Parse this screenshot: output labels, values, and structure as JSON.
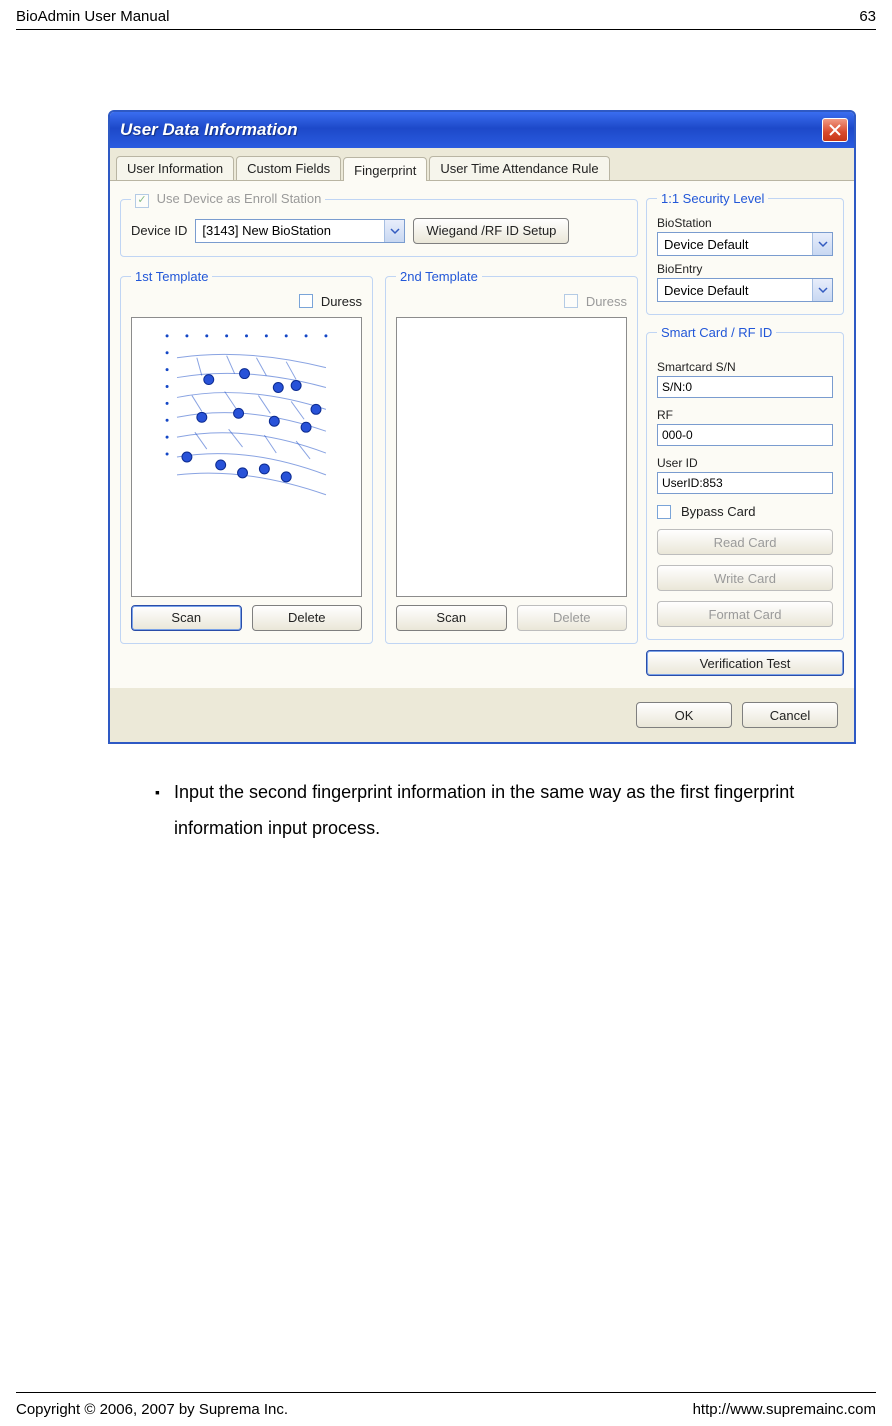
{
  "page_header": {
    "title": "BioAdmin User Manual",
    "page_number": "63"
  },
  "page_footer": {
    "copyright": "Copyright © 2006, 2007 by Suprema Inc.",
    "url": "http://www.supremainc.com"
  },
  "dialog": {
    "title": "User Data Information",
    "tabs": [
      "User Information",
      "Custom Fields",
      "Fingerprint",
      "User Time Attendance Rule"
    ],
    "active_tab_index": 2,
    "enroll": {
      "legend": "Use Device as Enroll Station",
      "device_id_label": "Device ID",
      "device_value": "[3143] New BioStation",
      "wiegand_btn": "Wiegand /RF ID Setup"
    },
    "tmpl1": {
      "legend": "1st Template",
      "duress": "Duress",
      "scan": "Scan",
      "delete": "Delete"
    },
    "tmpl2": {
      "legend": "2nd Template",
      "duress": "Duress",
      "scan": "Scan",
      "delete": "Delete"
    },
    "security": {
      "legend": "1:1 Security Level",
      "biostation_lbl": "BioStation",
      "biostation_val": "Device Default",
      "bioentry_lbl": "BioEntry",
      "bioentry_val": "Device Default"
    },
    "smartcard": {
      "legend": "Smart Card / RF ID",
      "sn_lbl": "Smartcard S/N",
      "sn_val": "S/N:0",
      "rf_lbl": "RF",
      "rf_val": "000-0",
      "userid_lbl": "User ID",
      "userid_val": "UserID:853",
      "bypass": "Bypass Card",
      "btn_read": "Read Card",
      "btn_write": "Write Card",
      "btn_format": "Format Card"
    },
    "verification_btn": "Verification Test",
    "ok": "OK",
    "cancel": "Cancel"
  },
  "bullet_text": "Input the second fingerprint information in the same way as the first fingerprint information input process."
}
